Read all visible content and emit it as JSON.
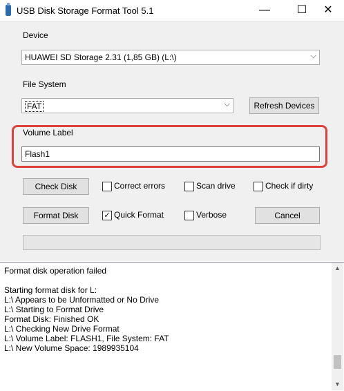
{
  "window": {
    "title": "USB Disk Storage Format Tool 5.1",
    "min": "—",
    "max": "☐",
    "close": "✕"
  },
  "device": {
    "label": "Device",
    "value": "HUAWEI  SD Storage  2.31 (1,85 GB) (L:\\)"
  },
  "filesystem": {
    "label": "File System",
    "value": "FAT",
    "refresh": "Refresh Devices"
  },
  "volume": {
    "label": "Volume Label",
    "value": "Flash1"
  },
  "actions": {
    "check_disk": "Check Disk",
    "correct_errors": "Correct errors",
    "scan_drive": "Scan drive",
    "check_if_dirty": "Check if dirty",
    "format_disk": "Format Disk",
    "quick_format": "Quick Format",
    "verbose": "Verbose",
    "cancel": "Cancel"
  },
  "checkboxes": {
    "correct_errors": false,
    "scan_drive": false,
    "check_if_dirty": false,
    "quick_format": true,
    "verbose": false
  },
  "log": [
    "Format disk operation failed",
    "",
    "Starting format disk for L:",
    "L:\\ Appears to be Unformatted or No Drive",
    "L:\\ Starting to Format Drive",
    "Format Disk: Finished OK",
    "L:\\ Checking New Drive Format",
    "L:\\ Volume Label: FLASH1, File System: FAT",
    "L:\\ New Volume Space: 1989935104"
  ],
  "colors": {
    "highlight": "#e0413a"
  }
}
